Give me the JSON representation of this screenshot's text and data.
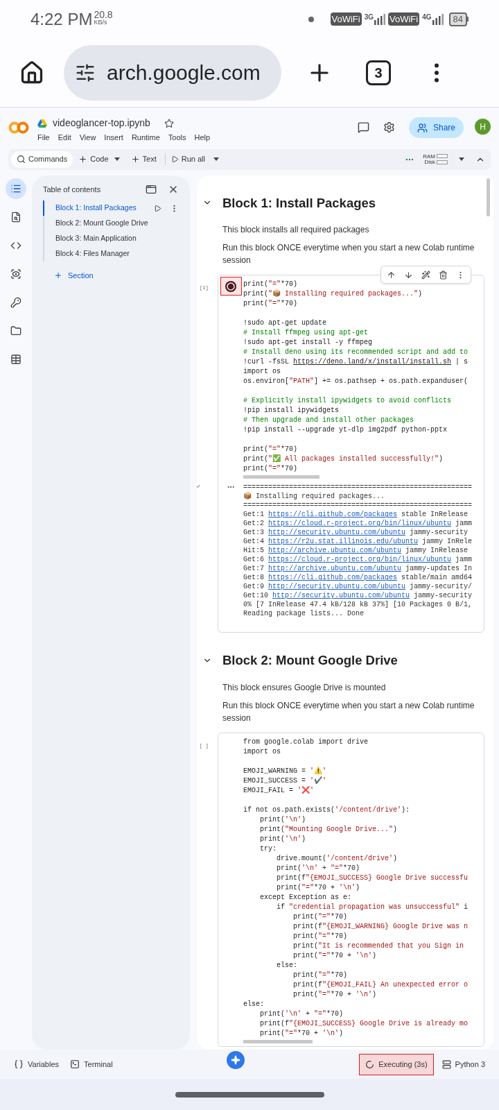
{
  "status_bar": {
    "time": "4:22 PM",
    "speed": "20.8",
    "speed_unit": "KB/s",
    "sims": [
      {
        "badge": "VoWiFi",
        "network": "3G"
      },
      {
        "badge": "VoWiFi",
        "network": "4G"
      }
    ],
    "battery": "84"
  },
  "browser": {
    "url": "arch.google.com",
    "tab_count": "3"
  },
  "notebook": {
    "title": "videoglancer-top.ipynb",
    "menu": [
      "File",
      "Edit",
      "View",
      "Insert",
      "Runtime",
      "Tools",
      "Help"
    ],
    "share": "Share",
    "avatar": "H"
  },
  "toolbar": {
    "commands": "Commands",
    "code": "Code",
    "text": "Text",
    "run_all": "Run all",
    "ram": "RAM",
    "disk": "Disk"
  },
  "rail": [
    {
      "kind": "toc",
      "selected": true
    },
    {
      "kind": "find",
      "selected": false
    },
    {
      "kind": "snippets",
      "selected": false
    },
    {
      "kind": "inspect",
      "selected": false
    },
    {
      "kind": "secrets",
      "selected": false
    },
    {
      "kind": "files",
      "selected": false
    },
    {
      "kind": "data",
      "selected": false
    }
  ],
  "toc": {
    "title": "Table of contents",
    "items": [
      {
        "label": "Block 1: Install Packages",
        "selected": true
      },
      {
        "label": "Block 2: Mount Google Drive",
        "selected": false
      },
      {
        "label": "Block 3: Main Application",
        "selected": false
      },
      {
        "label": "Block 4: Files Manager",
        "selected": false
      }
    ],
    "add_section": "Section"
  },
  "sections": [
    {
      "heading": "Block 1: Install Packages",
      "paragraphs": [
        "This block installs all required packages",
        "Run this block ONCE everytime when you start a new Colab runtime session"
      ],
      "cell": {
        "count": "[1]",
        "running": true,
        "toolbar": true,
        "lines": [
          {
            "kind": "code",
            "text": "print(\"=\"*70)"
          },
          {
            "kind": "code",
            "text": "print(\"📦 Installing required packages...\")"
          },
          {
            "kind": "code",
            "text": "print(\"=\"*70)"
          },
          {
            "kind": "blank"
          },
          {
            "kind": "code",
            "text": "!sudo apt-get update"
          },
          {
            "kind": "comment",
            "text": "# Install ffmpeg using apt-get"
          },
          {
            "kind": "code",
            "text": "!sudo apt-get install -y ffmpeg"
          },
          {
            "kind": "comment",
            "text": "# Install deno using its recommended script and add to"
          },
          {
            "kind": "link",
            "text": "!curl -fsSL ",
            "link": "https://deno.land/x/install/install.sh",
            "rest": " | s"
          },
          {
            "kind": "code",
            "text": "import os"
          },
          {
            "kind": "code",
            "text": "os.environ[\"PATH\"] += os.pathsep + os.path.expanduser("
          },
          {
            "kind": "blank"
          },
          {
            "kind": "comment",
            "text": "# Explicitly install ipywidgets to avoid conflicts"
          },
          {
            "kind": "code",
            "text": "!pip install ipywidgets"
          },
          {
            "kind": "comment",
            "text": "# Then upgrade and install other packages"
          },
          {
            "kind": "code",
            "text": "!pip install --upgrade yt-dlp img2pdf python-pptx"
          },
          {
            "kind": "blank"
          },
          {
            "kind": "code",
            "text": "print(\"=\"*70)"
          },
          {
            "kind": "code",
            "text": "print(\"✅ All packages installed successfully!\")"
          },
          {
            "kind": "code",
            "text": "print(\"=\"*70)"
          }
        ],
        "output": [
          {
            "text": "======================================================="
          },
          {
            "text": "📦 Installing required packages..."
          },
          {
            "text": "======================================================="
          },
          {
            "text": "Get:1 ",
            "link": "https://cli.github.com/packages",
            "rest": " stable InRelease"
          },
          {
            "text": "Get:2 ",
            "link": "https://cloud.r-project.org/bin/linux/ubuntu",
            "rest": " jamm"
          },
          {
            "text": "Get:3 ",
            "link": "http://security.ubuntu.com/ubuntu",
            "rest": " jammy-security"
          },
          {
            "text": "Get:4 ",
            "link": "https://r2u.stat.illinois.edu/ubuntu",
            "rest": " jammy InRele"
          },
          {
            "text": "Hit:5 ",
            "link": "http://archive.ubuntu.com/ubuntu",
            "rest": " jammy InRelease"
          },
          {
            "text": "Get:6 ",
            "link": "https://cloud.r-project.org/bin/linux/ubuntu",
            "rest": " jamm"
          },
          {
            "text": "Get:7 ",
            "link": "http://archive.ubuntu.com/ubuntu",
            "rest": " jammy-updates In"
          },
          {
            "text": "Get:8 ",
            "link": "https://cli.github.com/packages",
            "rest": " stable/main amd64"
          },
          {
            "text": "Get:9 ",
            "link": "http://security.ubuntu.com/ubuntu",
            "rest": " jammy-security/"
          },
          {
            "text": "Get:10 ",
            "link": "http://security.ubuntu.com/ubuntu",
            "rest": " jammy-security"
          },
          {
            "text": "0% [7 InRelease 47.4 kB/128 kB 37%] [10 Packages 0 B/1,"
          },
          {
            "text": "Reading package lists... Done"
          }
        ]
      }
    },
    {
      "heading": "Block 2: Mount Google Drive",
      "paragraphs": [
        "This block ensures Google Drive is mounted",
        "Run this block ONCE everytime when you start a new Colab runtime session"
      ],
      "cell": {
        "count": "[ ]",
        "running": false,
        "toolbar": false,
        "lines": [
          {
            "kind": "code",
            "text": "from google.colab import drive"
          },
          {
            "kind": "code",
            "text": "import os"
          },
          {
            "kind": "blank"
          },
          {
            "kind": "code",
            "text": "EMOJI_WARNING = '⚠️'"
          },
          {
            "kind": "code",
            "text": "EMOJI_SUCCESS = '✔️'"
          },
          {
            "kind": "code",
            "text": "EMOJI_FAIL = '❌'"
          },
          {
            "kind": "blank"
          },
          {
            "kind": "code",
            "text": "if not os.path.exists('/content/drive'):"
          },
          {
            "kind": "code",
            "text": "    print('\\n')"
          },
          {
            "kind": "code",
            "text": "    print(\"Mounting Google Drive...\")"
          },
          {
            "kind": "code",
            "text": "    print('\\n')"
          },
          {
            "kind": "code",
            "text": "    try:"
          },
          {
            "kind": "code",
            "text": "        drive.mount('/content/drive')"
          },
          {
            "kind": "code",
            "text": "        print('\\n' + \"=\"*70)"
          },
          {
            "kind": "code",
            "text": "        print(f\"{EMOJI_SUCCESS} Google Drive successfu"
          },
          {
            "kind": "code",
            "text": "        print(\"=\"*70 + '\\n')"
          },
          {
            "kind": "code",
            "text": "    except Exception as e:"
          },
          {
            "kind": "code",
            "text": "        if \"credential propagation was unsuccessful\" i"
          },
          {
            "kind": "code",
            "text": "            print(\"=\"*70)"
          },
          {
            "kind": "code",
            "text": "            print(f\"{EMOJI_WARNING} Google Drive was n"
          },
          {
            "kind": "code",
            "text": "            print(\"=\"*70)"
          },
          {
            "kind": "code",
            "text": "            print(\"It is recommended that you Sign in"
          },
          {
            "kind": "code",
            "text": "            print(\"=\"*70 + '\\n')"
          },
          {
            "kind": "code",
            "text": "        else:"
          },
          {
            "kind": "code",
            "text": "            print(\"=\"*70)"
          },
          {
            "kind": "code",
            "text": "            print(f\"{EMOJI_FAIL} An unexpected error o"
          },
          {
            "kind": "code",
            "text": "            print(\"=\"*70 + '\\n')"
          },
          {
            "kind": "code",
            "text": "else:"
          },
          {
            "kind": "code",
            "text": "    print('\\n' + \"=\"*70)"
          },
          {
            "kind": "code",
            "text": "    print(f\"{EMOJI_SUCCESS} Google Drive is already mo"
          },
          {
            "kind": "code",
            "text": "    print(\"=\"*70 + '\\n')"
          }
        ]
      }
    }
  ],
  "bottom_bar": {
    "variables": "Variables",
    "terminal": "Terminal",
    "status": "Executing (3s)",
    "runtime": "Python 3"
  }
}
